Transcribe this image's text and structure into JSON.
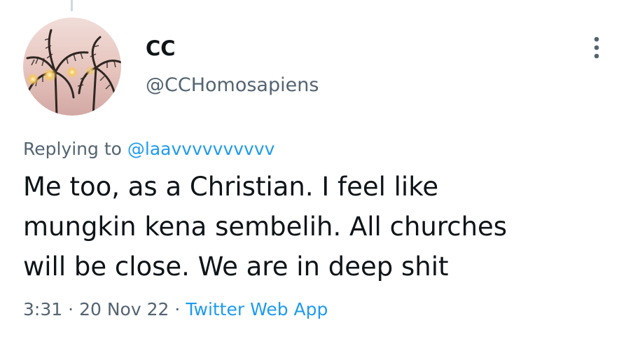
{
  "author": {
    "display_name": "CC",
    "handle": "@CCHomosapiens",
    "avatar_icon": "palm-tree-avatar-icon"
  },
  "more_icon": "three-dots-vertical-icon",
  "reply": {
    "prefix": "Replying to",
    "mention": "@laavvvvvvvvvv"
  },
  "tweet": {
    "lines": [
      "Me too, as a Christian. I feel like",
      "mungkin kena sembelih. All churches",
      "will be close. We are in deep shit"
    ]
  },
  "meta": {
    "time": "3:31",
    "separator": "·",
    "date": "20 Nov 22",
    "source": "Twitter Web App"
  },
  "colors": {
    "text_primary": "#0f1419",
    "text_secondary": "#536471",
    "link": "#1d9bf0",
    "thread_line": "#cfd9de"
  }
}
